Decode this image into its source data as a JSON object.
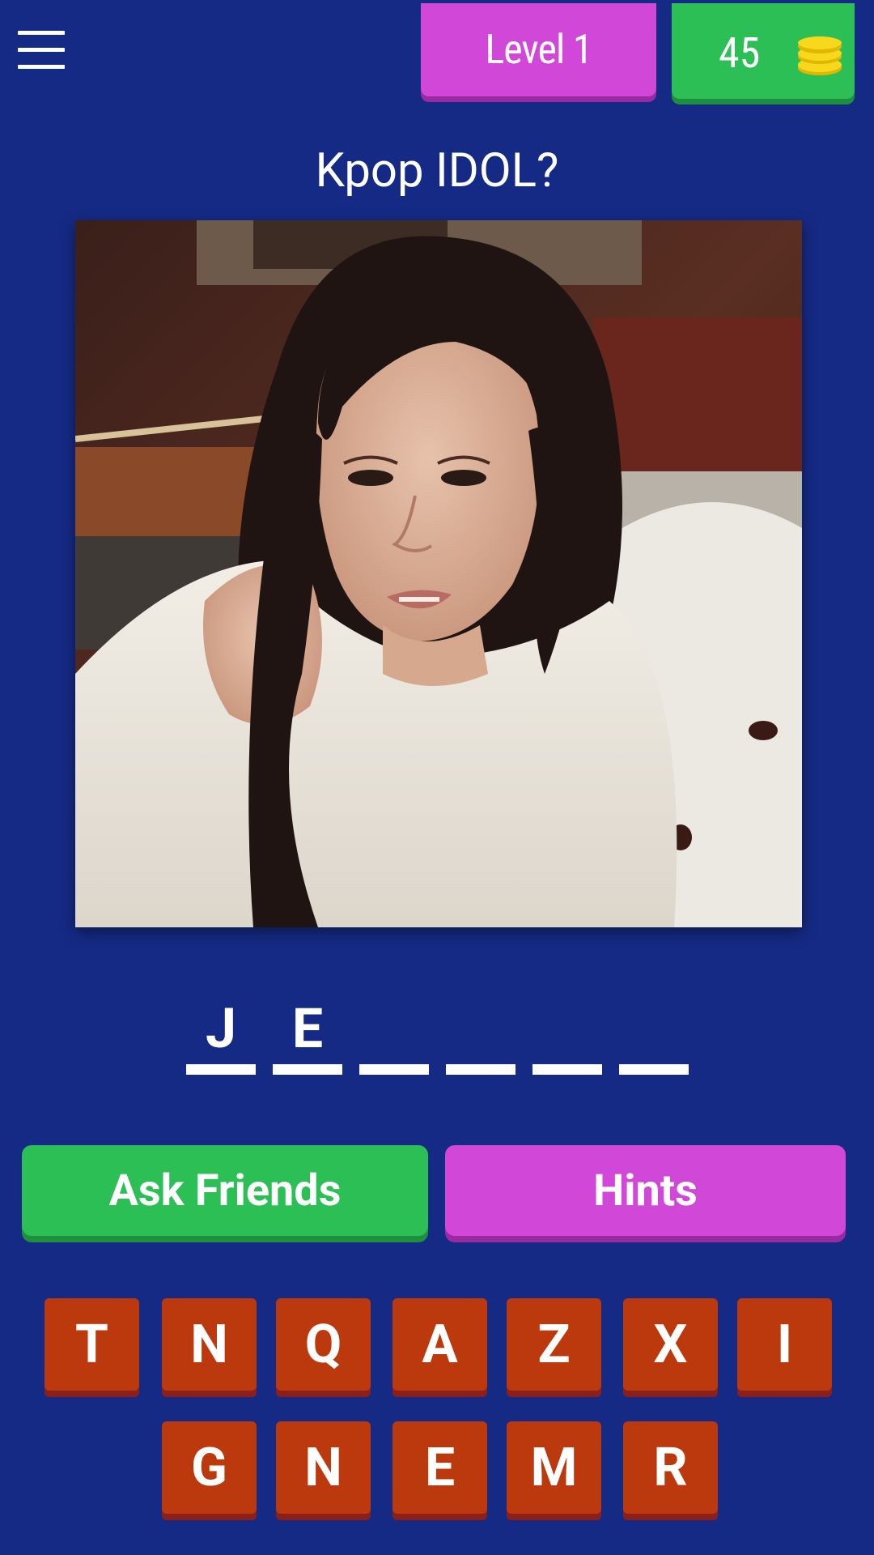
{
  "header": {
    "menu_icon": "hamburger-menu-icon",
    "level_label": "Level 1",
    "coins": "45",
    "coin_icon": "coin-stack-icon"
  },
  "question": "Kpop IDOL?",
  "answer_slots": [
    "J",
    "E",
    "",
    "",
    "",
    ""
  ],
  "actions": {
    "ask_friends_label": "Ask Friends",
    "hints_label": "Hints"
  },
  "keyboard": {
    "row1": [
      "T",
      "N",
      "Q",
      "A",
      "Z",
      "X",
      "I"
    ],
    "row2": [
      "G",
      "N",
      "E",
      "M",
      "R"
    ]
  },
  "colors": {
    "background": "#152a85",
    "green": "#2bbf55",
    "purple": "#d147d8",
    "key_red": "#bc390d",
    "coin_yellow": "#f7d81c"
  }
}
